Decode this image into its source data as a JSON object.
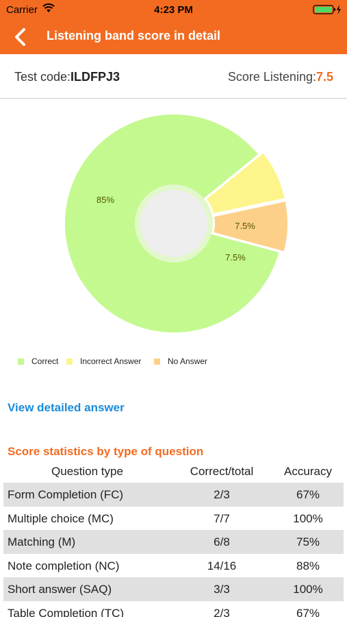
{
  "status": {
    "carrier": "Carrier",
    "time": "4:23 PM"
  },
  "nav": {
    "title": "Listening band score in detail"
  },
  "info": {
    "code_label": "Test code:",
    "code_value": "ILDFPJ3",
    "score_label": "Score Listening:",
    "score_value": "7.5"
  },
  "chart_data": {
    "type": "pie",
    "categories": [
      "Correct",
      "Incorrect Answer",
      "No Answer"
    ],
    "values": [
      85,
      7.5,
      7.5
    ],
    "labels": [
      "85%",
      "7.5%",
      "7.5%"
    ],
    "colors": [
      "#c3f98f",
      "#fdf48c",
      "#fdd08a"
    ],
    "legend_position": "bottom-left"
  },
  "link": {
    "view_detailed": "View detailed answer"
  },
  "stats": {
    "title": "Score statistics by type of question",
    "headers": [
      "Question type",
      "Correct/total",
      "Accuracy"
    ],
    "rows": [
      [
        "Form Completion (FC)",
        "2/3",
        "67%"
      ],
      [
        "Multiple choice (MC)",
        "7/7",
        "100%"
      ],
      [
        "Matching (M)",
        "6/8",
        "75%"
      ],
      [
        "Note completion (NC)",
        "14/16",
        "88%"
      ],
      [
        "Short answer (SAQ)",
        "3/3",
        "100%"
      ],
      [
        "Table Completion (TC)",
        "2/3",
        "67%"
      ]
    ]
  }
}
